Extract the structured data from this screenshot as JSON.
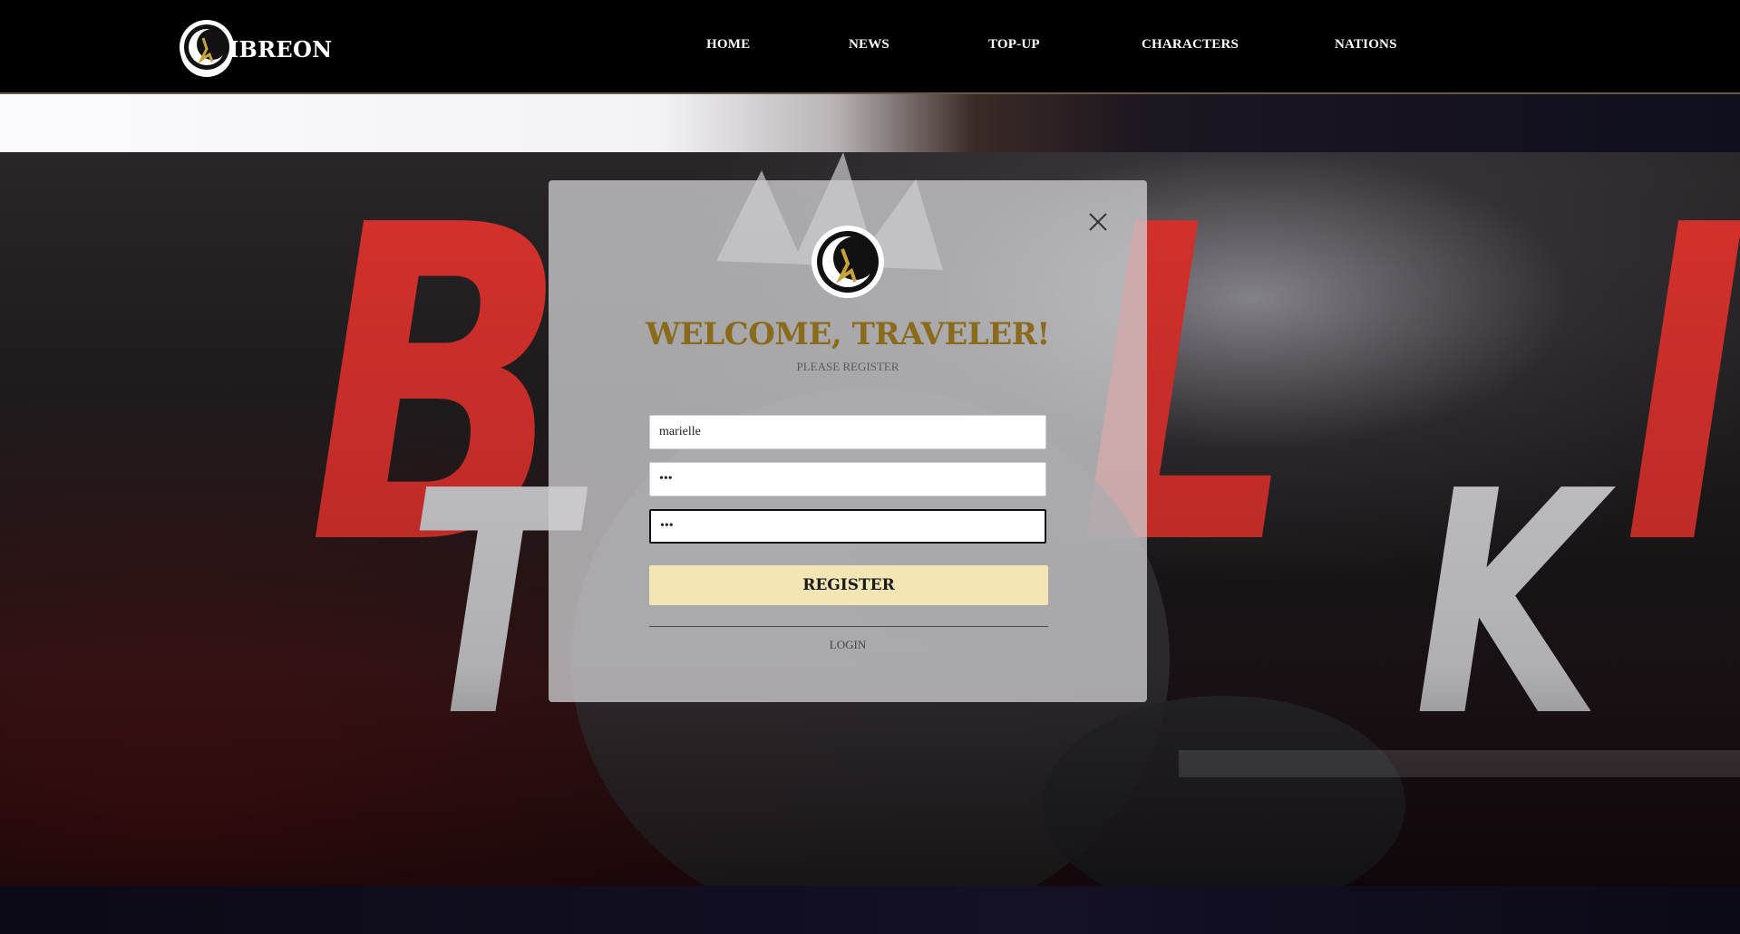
{
  "header": {
    "brand_text": "IBREON",
    "nav": [
      "HOME",
      "NEWS",
      "TOP-UP",
      "CHARACTERS",
      "NATIONS"
    ]
  },
  "hero": {
    "letters_red": [
      "B",
      "L",
      "I"
    ],
    "letters_white": [
      "T",
      "K"
    ]
  },
  "modal": {
    "title": "WELCOME, TRAVELER!",
    "subtitle": "PLEASE REGISTER",
    "username_value": "marielle",
    "password_value": "•••",
    "confirm_value": "•••",
    "register_label": "REGISTER",
    "login_label": "LOGIN"
  },
  "colors": {
    "accent_gold": "#8a6b1d",
    "button_bg": "#f3e6b4",
    "hero_red": "#d6312c"
  },
  "icons": {
    "logo": "crescent-moon-emblem-icon",
    "close": "close-icon"
  }
}
